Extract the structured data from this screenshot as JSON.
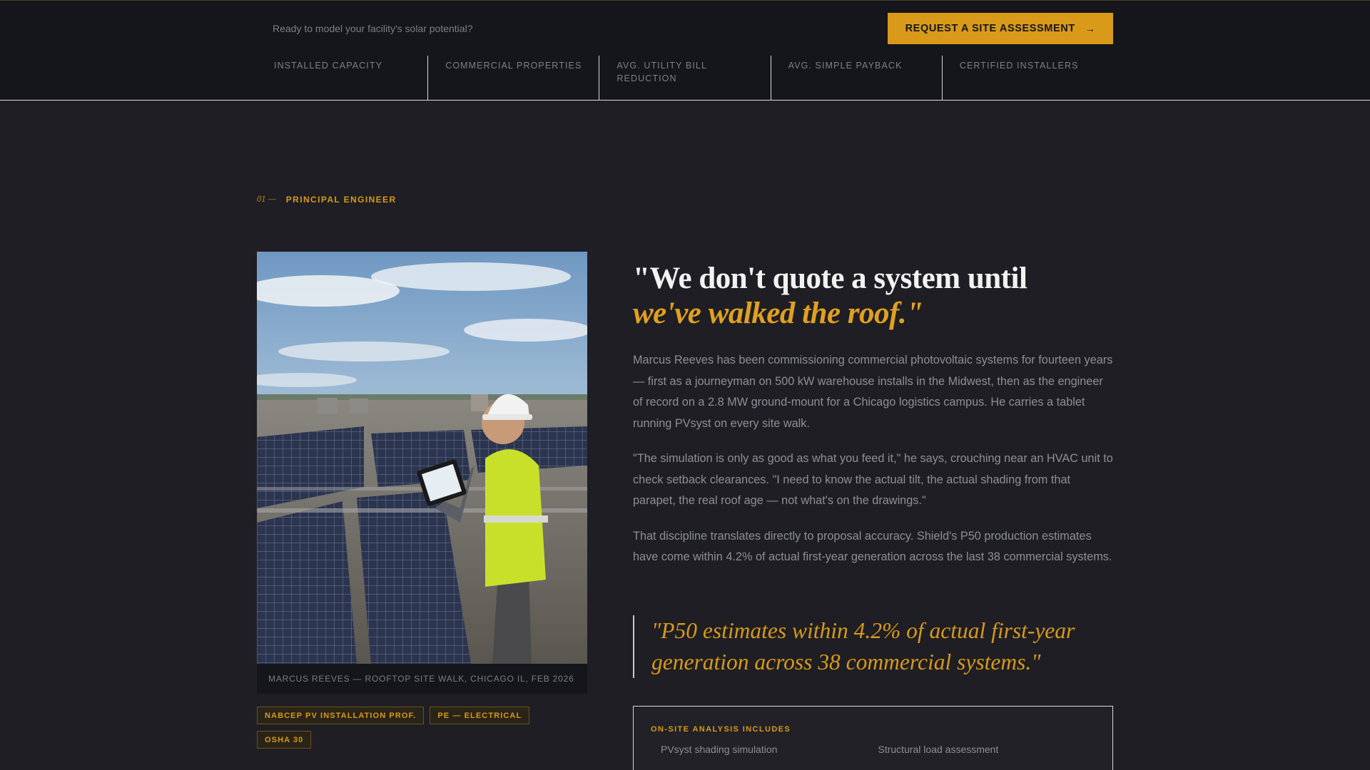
{
  "topbar": {
    "prompt": "Ready to model your facility's solar potential?",
    "cta_label": "REQUEST A SITE ASSESSMENT",
    "cta_icon": "arrow-right-icon",
    "stats": [
      {
        "label": "INSTALLED CAPACITY"
      },
      {
        "label": "COMMERCIAL PROPERTIES"
      },
      {
        "label": "AVG. UTILITY BILL REDUCTION"
      },
      {
        "label": "AVG. SIMPLE PAYBACK"
      },
      {
        "label": "CERTIFIED INSTALLERS"
      }
    ]
  },
  "section": {
    "number": "01 —",
    "eyebrow": "PRINCIPAL ENGINEER"
  },
  "profile": {
    "photo_caption": "MARCUS REEVES — ROOFTOP SITE WALK, CHICAGO IL, FEB 2026",
    "credentials": [
      "NABCEP PV INSTALLATION PROF.",
      "PE — ELECTRICAL",
      "OSHA 30"
    ]
  },
  "article": {
    "headline_line1": "\"We don't quote a system until",
    "headline_line2": "we've walked the roof.\"",
    "paragraphs": [
      "Marcus Reeves has been commissioning commercial photovoltaic systems for fourteen years — first as a journeyman on 500 kW warehouse installs in the Midwest, then as the engineer of record on a 2.8 MW ground-mount for a Chicago logistics campus. He carries a tablet running PVsyst on every site walk.",
      "\"The simulation is only as good as what you feed it,\" he says, crouching near an HVAC unit to check setback clearances. \"I need to know the actual tilt, the actual shading from that parapet, the real roof age — not what's on the drawings.\"",
      "That discipline translates directly to proposal accuracy. Shield's P50 production estimates have come within 4.2% of actual first-year generation across the last 38 commercial systems."
    ],
    "pull_quote": "\"P50 estimates within 4.2% of actual first-year generation across 38 commercial systems.\""
  },
  "analysis": {
    "title": "ON-SITE ANALYSIS INCLUDES",
    "items": [
      "PVsyst shading simulation",
      "Structural load assessment"
    ]
  },
  "colors": {
    "accent": "#D89A18",
    "background": "#1E1E24",
    "topbar": "#15161B"
  }
}
